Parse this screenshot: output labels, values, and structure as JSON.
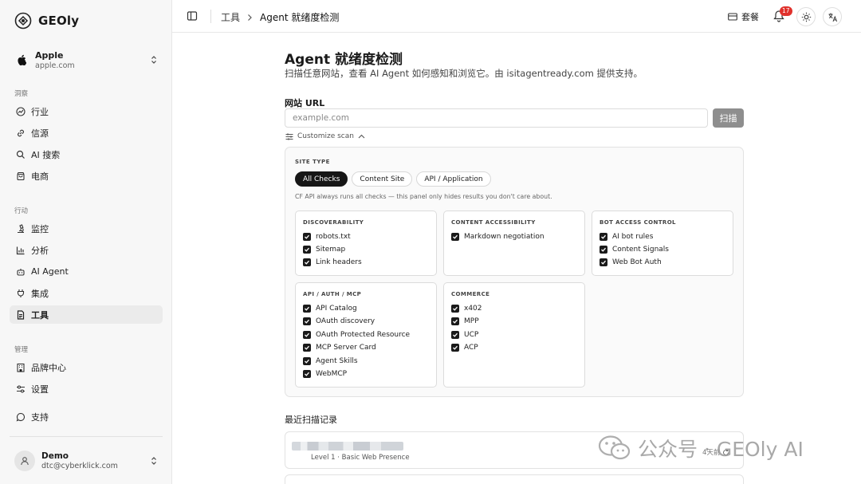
{
  "brand": {
    "name": "GEOly"
  },
  "account": {
    "name": "Apple",
    "domain": "apple.com"
  },
  "sidebar": {
    "sections": {
      "insights": "洞察",
      "actions": "行动",
      "manage": "管理"
    },
    "insights_items": [
      {
        "label": "行业",
        "icon": "trend-icon"
      },
      {
        "label": "信源",
        "icon": "link-icon"
      },
      {
        "label": "AI 搜索",
        "icon": "search-icon"
      },
      {
        "label": "电商",
        "icon": "bag-icon"
      }
    ],
    "action_items": [
      {
        "label": "监控",
        "icon": "microscope-icon"
      },
      {
        "label": "分析",
        "icon": "bar-chart-icon"
      },
      {
        "label": "AI Agent",
        "icon": "agent-icon"
      },
      {
        "label": "集成",
        "icon": "plug-icon"
      },
      {
        "label": "工具",
        "icon": "document-icon"
      }
    ],
    "manage_items": [
      {
        "label": "品牌中心",
        "icon": "building-icon"
      },
      {
        "label": "设置",
        "icon": "sliders-icon"
      }
    ],
    "support": {
      "label": "支持",
      "icon": "chat-icon"
    }
  },
  "user": {
    "name": "Demo",
    "email": "dtc@cyberklick.com"
  },
  "topbar": {
    "breadcrumb_parent": "工具",
    "breadcrumb_current": "Agent 就绪度检测",
    "plan_label": "套餐",
    "notification_count": "17"
  },
  "main": {
    "title": "Agent 就绪度检测",
    "subtitle": "扫描任意网站，查看 AI Agent 如何感知和浏览它。由 isitagentready.com 提供支持。",
    "url_label": "网站 URL",
    "url_placeholder": "example.com",
    "scan_label": "扫描",
    "customize_label": "Customize scan"
  },
  "panel": {
    "site_type_label": "SITE TYPE",
    "pills": [
      "All Checks",
      "Content Site",
      "API / Application"
    ],
    "note": "CF API always runs all checks — this panel only hides results you don't care about.",
    "groups": [
      {
        "title": "DISCOVERABILITY",
        "items": [
          "robots.txt",
          "Sitemap",
          "Link headers"
        ]
      },
      {
        "title": "CONTENT ACCESSIBILITY",
        "items": [
          "Markdown negotiation"
        ]
      },
      {
        "title": "BOT ACCESS CONTROL",
        "items": [
          "AI bot rules",
          "Content Signals",
          "Web Bot Auth"
        ]
      },
      {
        "title": "API / AUTH / MCP",
        "items": [
          "API Catalog",
          "OAuth discovery",
          "OAuth Protected Resource",
          "MCP Server Card",
          "Agent Skills",
          "WebMCP"
        ]
      },
      {
        "title": "COMMERCE",
        "items": [
          "x402",
          "MPP",
          "UCP",
          "ACP"
        ]
      }
    ]
  },
  "recent": {
    "label": "最近扫描记录",
    "records": [
      {
        "level": "Level 1 · Basic Web Presence",
        "time": "4天前"
      }
    ]
  },
  "watermark": {
    "text": "公众号 · GEOly AI"
  }
}
